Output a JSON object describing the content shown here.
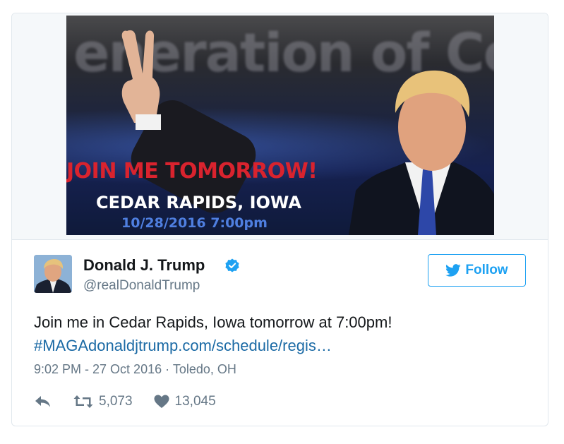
{
  "media": {
    "background_text": "eneration of Co",
    "line1": "JOIN ME TOMORROW!",
    "line2": "CEDAR RAPIDS, IOWA",
    "line3": "10/28/2016 7:00pm"
  },
  "author": {
    "name": "Donald J. Trump",
    "handle": "@realDonaldTrump",
    "verified": true
  },
  "follow_button": {
    "label": "Follow",
    "icon": "bird-icon"
  },
  "tweet": {
    "text": "Join me in Cedar Rapids, Iowa tomorrow at 7:00pm!",
    "link": "#MAGAdonaldjtrump.com/schedule/regis…",
    "timestamp": "9:02 PM - 27 Oct 2016",
    "separator": "·",
    "location": "Toledo, OH"
  },
  "stats": {
    "retweets": "5,073",
    "likes": "13,045"
  },
  "colors": {
    "brand_blue": "#1da1f2",
    "link_blue": "#1b6aa5",
    "headline_red": "#d9232e",
    "secondary_text": "#657786"
  }
}
